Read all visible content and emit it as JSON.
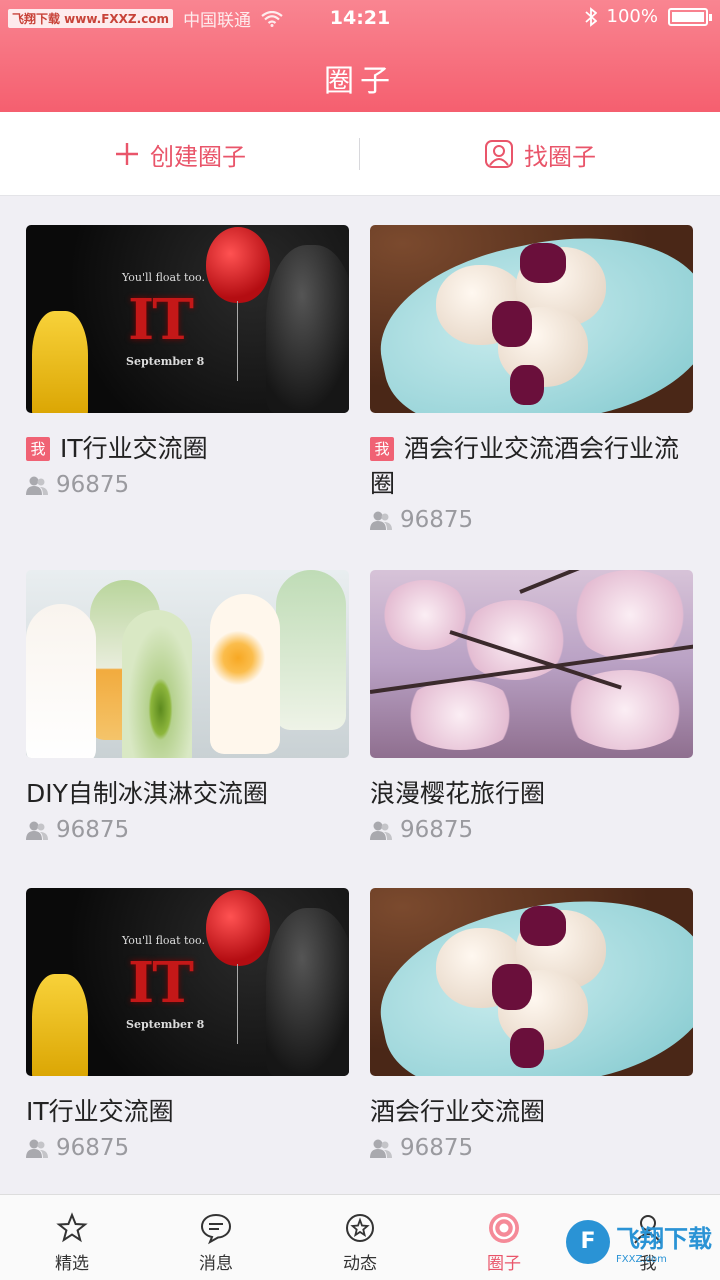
{
  "status_bar": {
    "watermark": "飞翔下载 www.FXXZ.com",
    "carrier": "中国联通",
    "time": "14:21",
    "battery": "100%"
  },
  "header": {
    "title": "圈子"
  },
  "actions": {
    "create": "创建圈子",
    "find": "找圈子"
  },
  "badges": {
    "mine": "我"
  },
  "thumb_text": {
    "tagline": "You'll float too.",
    "logo": "IT",
    "date": "September 8"
  },
  "circles": [
    {
      "name": "IT行业交流圈",
      "members": "96875",
      "mine": true
    },
    {
      "name": "酒会行业交流酒会行业流圈",
      "members": "96875",
      "mine": true
    },
    {
      "name": "DIY自制冰淇淋交流圈",
      "members": "96875",
      "mine": false
    },
    {
      "name": "浪漫樱花旅行圈",
      "members": "96875",
      "mine": false
    },
    {
      "name": "IT行业交流圈",
      "members": "96875",
      "mine": false
    },
    {
      "name": "酒会行业交流圈",
      "members": "96875",
      "mine": false
    }
  ],
  "tabs": [
    {
      "label": "精选",
      "icon": "star-icon"
    },
    {
      "label": "消息",
      "icon": "message-icon"
    },
    {
      "label": "动态",
      "icon": "feed-icon"
    },
    {
      "label": "圈子",
      "icon": "circle-icon",
      "active": true
    },
    {
      "label": "我",
      "icon": "profile-icon"
    }
  ],
  "bottom_watermark": {
    "text": "飞翔下载",
    "sub": "FXXZ.com",
    "glyph": "F"
  },
  "colors": {
    "accent": "#e9556a",
    "header_top": "#f98591",
    "header_bottom": "#f55f6f"
  }
}
